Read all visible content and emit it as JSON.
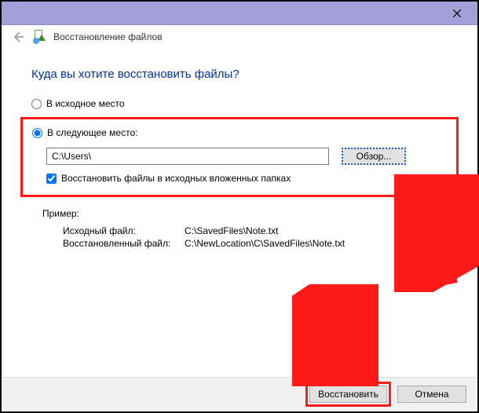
{
  "titlebar": {},
  "header": {
    "title": "Восстановление файлов"
  },
  "main": {
    "heading": "Куда вы хотите восстановить файлы?",
    "option_original": "В исходное место",
    "option_following": "В следующее место:",
    "path_value": "C:\\Users\\",
    "browse_label": "Обзор...",
    "checkbox_label": "Восстановить файлы в исходных вложенных папках",
    "example_title": "Пример:",
    "example_src_label": "Исходный файл:",
    "example_src_value": "C:\\SavedFiles\\Note.txt",
    "example_dst_label": "Восстановленный файл:",
    "example_dst_value": "C:\\NewLocation\\C\\SavedFiles\\Note.txt"
  },
  "footer": {
    "restore_label": "Восстановить",
    "cancel_label": "Отмена"
  }
}
